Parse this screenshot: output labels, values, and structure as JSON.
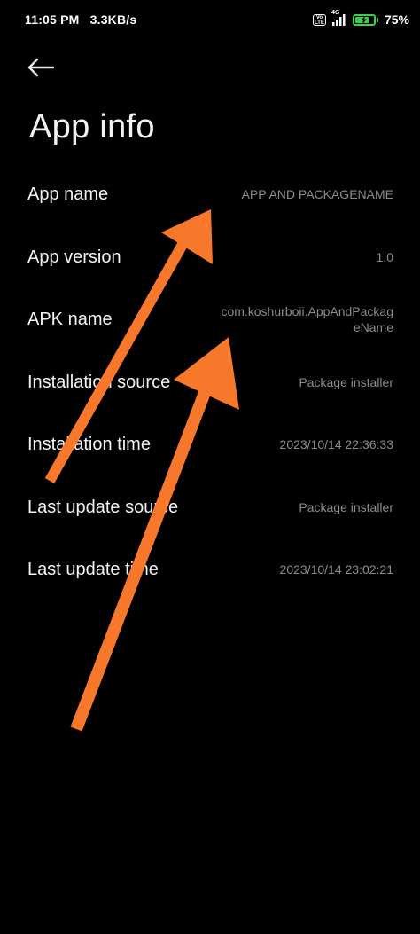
{
  "status_bar": {
    "time": "11:05 PM",
    "net_speed": "3.3KB/s",
    "volte_label": "Vo LTE",
    "network_type": "4G",
    "battery_percent_text": "75%",
    "battery_level": 0.75,
    "icons": [
      "volte-icon",
      "signal-icon",
      "battery-charging-icon"
    ],
    "battery_color": "#3ccf4e"
  },
  "header": {
    "back_icon": "arrow-left-icon",
    "title": "App info"
  },
  "info": [
    {
      "label": "App name",
      "value": "APP AND PACKAGENAME"
    },
    {
      "label": "App version",
      "value": "1.0"
    },
    {
      "label": "APK name",
      "value": "com.koshurboii.AppAndPackageName"
    },
    {
      "label": "Installation source",
      "value": "Package installer"
    },
    {
      "label": "Installation time",
      "value": "2023/10/14 22:36:33"
    },
    {
      "label": "Last update source",
      "value": "Package installer"
    },
    {
      "label": "Last update time",
      "value": "2023/10/14 23:02:21"
    }
  ],
  "annotations": {
    "arrow_color": "#f7782a"
  }
}
